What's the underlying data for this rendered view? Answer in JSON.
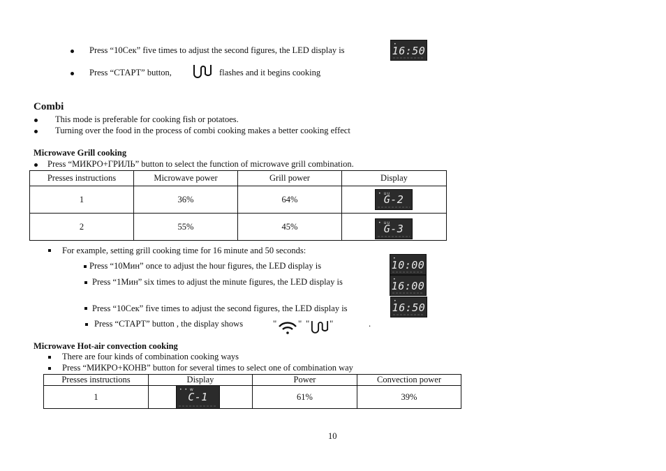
{
  "intro_steps": [
    {
      "text": "Press “10Сек”  five times to adjust the second figures,  the LED display  is",
      "display": "16:50"
    },
    {
      "text_before": "Press “СТАРТ”  button,",
      "icon": "grill-icon",
      "text_after": "flashes and it begins cooking"
    }
  ],
  "combi": {
    "title": "Combi",
    "bullets": [
      "This mode is preferable for cooking fish or potatoes.",
      "Turning over the food in the process of combi cooking makes a better cooking effect"
    ]
  },
  "grill_section": {
    "title": "Microwave Grill cooking",
    "instruction": "Press “МИКРО+ГРИЛЬ”  button to select the function of microwave grill combination.",
    "table": {
      "headers": [
        "Presses instructions",
        "Microwave power",
        "Grill power",
        "Display"
      ],
      "rows": [
        {
          "presses": "1",
          "microwave_power": "36%",
          "grill_power": "64%",
          "display": "G-2"
        },
        {
          "presses": "2",
          "microwave_power": "55%",
          "grill_power": "45%",
          "display": "G-3"
        }
      ]
    },
    "example": {
      "intro": "For example, setting grill cooking time for 16 minute and 50 seconds:",
      "steps": [
        {
          "text": "Press  “10Мин” once to adjust the hour figures, the LED display  is",
          "display": "10:00"
        },
        {
          "text": "Press  “1Мин”  six times to adjust the minute figures, the LED display is",
          "display": "16:00"
        },
        {
          "text": "Press “10Сек”  five times to adjust the second figures,  the LED display  is",
          "display": "16:50"
        },
        {
          "text": "Press “СТАРТ”   button , the display shows",
          "icons": [
            "microwave-wave-icon",
            "grill-icon"
          ],
          "end": "."
        }
      ]
    }
  },
  "convection_section": {
    "title": "Microwave Hot-air  convection cooking",
    "bullets": [
      "There are four kinds of combination cooking ways",
      "Press “МИКРО+КОНВ”  button for several times to select one of combination way"
    ],
    "table": {
      "headers": [
        "Presses instructions",
        "Display",
        "Power",
        "Convection power"
      ],
      "rows": [
        {
          "presses": "1",
          "display": "C-1",
          "power": "61%",
          "convection_power": "39%"
        }
      ]
    }
  },
  "page_number": "10"
}
